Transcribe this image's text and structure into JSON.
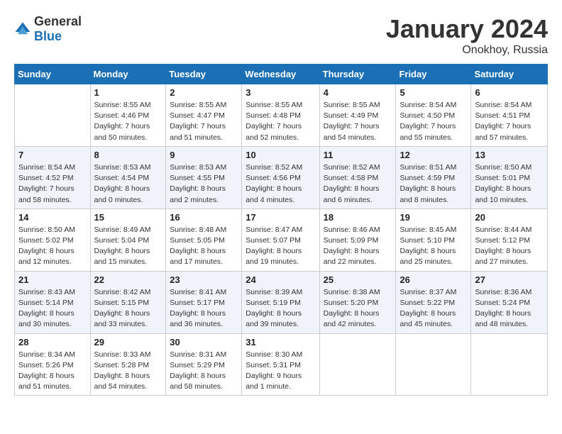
{
  "logo": {
    "general": "General",
    "blue": "Blue"
  },
  "title": "January 2024",
  "location": "Onokhoy, Russia",
  "days_of_week": [
    "Sunday",
    "Monday",
    "Tuesday",
    "Wednesday",
    "Thursday",
    "Friday",
    "Saturday"
  ],
  "weeks": [
    [
      {
        "day": "",
        "info": ""
      },
      {
        "day": "1",
        "info": "Sunrise: 8:55 AM\nSunset: 4:46 PM\nDaylight: 7 hours\nand 50 minutes."
      },
      {
        "day": "2",
        "info": "Sunrise: 8:55 AM\nSunset: 4:47 PM\nDaylight: 7 hours\nand 51 minutes."
      },
      {
        "day": "3",
        "info": "Sunrise: 8:55 AM\nSunset: 4:48 PM\nDaylight: 7 hours\nand 52 minutes."
      },
      {
        "day": "4",
        "info": "Sunrise: 8:55 AM\nSunset: 4:49 PM\nDaylight: 7 hours\nand 54 minutes."
      },
      {
        "day": "5",
        "info": "Sunrise: 8:54 AM\nSunset: 4:50 PM\nDaylight: 7 hours\nand 55 minutes."
      },
      {
        "day": "6",
        "info": "Sunrise: 8:54 AM\nSunset: 4:51 PM\nDaylight: 7 hours\nand 57 minutes."
      }
    ],
    [
      {
        "day": "7",
        "info": "Sunrise: 8:54 AM\nSunset: 4:52 PM\nDaylight: 7 hours\nand 58 minutes."
      },
      {
        "day": "8",
        "info": "Sunrise: 8:53 AM\nSunset: 4:54 PM\nDaylight: 8 hours\nand 0 minutes."
      },
      {
        "day": "9",
        "info": "Sunrise: 8:53 AM\nSunset: 4:55 PM\nDaylight: 8 hours\nand 2 minutes."
      },
      {
        "day": "10",
        "info": "Sunrise: 8:52 AM\nSunset: 4:56 PM\nDaylight: 8 hours\nand 4 minutes."
      },
      {
        "day": "11",
        "info": "Sunrise: 8:52 AM\nSunset: 4:58 PM\nDaylight: 8 hours\nand 6 minutes."
      },
      {
        "day": "12",
        "info": "Sunrise: 8:51 AM\nSunset: 4:59 PM\nDaylight: 8 hours\nand 8 minutes."
      },
      {
        "day": "13",
        "info": "Sunrise: 8:50 AM\nSunset: 5:01 PM\nDaylight: 8 hours\nand 10 minutes."
      }
    ],
    [
      {
        "day": "14",
        "info": "Sunrise: 8:50 AM\nSunset: 5:02 PM\nDaylight: 8 hours\nand 12 minutes."
      },
      {
        "day": "15",
        "info": "Sunrise: 8:49 AM\nSunset: 5:04 PM\nDaylight: 8 hours\nand 15 minutes."
      },
      {
        "day": "16",
        "info": "Sunrise: 8:48 AM\nSunset: 5:05 PM\nDaylight: 8 hours\nand 17 minutes."
      },
      {
        "day": "17",
        "info": "Sunrise: 8:47 AM\nSunset: 5:07 PM\nDaylight: 8 hours\nand 19 minutes."
      },
      {
        "day": "18",
        "info": "Sunrise: 8:46 AM\nSunset: 5:09 PM\nDaylight: 8 hours\nand 22 minutes."
      },
      {
        "day": "19",
        "info": "Sunrise: 8:45 AM\nSunset: 5:10 PM\nDaylight: 8 hours\nand 25 minutes."
      },
      {
        "day": "20",
        "info": "Sunrise: 8:44 AM\nSunset: 5:12 PM\nDaylight: 8 hours\nand 27 minutes."
      }
    ],
    [
      {
        "day": "21",
        "info": "Sunrise: 8:43 AM\nSunset: 5:14 PM\nDaylight: 8 hours\nand 30 minutes."
      },
      {
        "day": "22",
        "info": "Sunrise: 8:42 AM\nSunset: 5:15 PM\nDaylight: 8 hours\nand 33 minutes."
      },
      {
        "day": "23",
        "info": "Sunrise: 8:41 AM\nSunset: 5:17 PM\nDaylight: 8 hours\nand 36 minutes."
      },
      {
        "day": "24",
        "info": "Sunrise: 8:39 AM\nSunset: 5:19 PM\nDaylight: 8 hours\nand 39 minutes."
      },
      {
        "day": "25",
        "info": "Sunrise: 8:38 AM\nSunset: 5:20 PM\nDaylight: 8 hours\nand 42 minutes."
      },
      {
        "day": "26",
        "info": "Sunrise: 8:37 AM\nSunset: 5:22 PM\nDaylight: 8 hours\nand 45 minutes."
      },
      {
        "day": "27",
        "info": "Sunrise: 8:36 AM\nSunset: 5:24 PM\nDaylight: 8 hours\nand 48 minutes."
      }
    ],
    [
      {
        "day": "28",
        "info": "Sunrise: 8:34 AM\nSunset: 5:26 PM\nDaylight: 8 hours\nand 51 minutes."
      },
      {
        "day": "29",
        "info": "Sunrise: 8:33 AM\nSunset: 5:28 PM\nDaylight: 8 hours\nand 54 minutes."
      },
      {
        "day": "30",
        "info": "Sunrise: 8:31 AM\nSunset: 5:29 PM\nDaylight: 8 hours\nand 58 minutes."
      },
      {
        "day": "31",
        "info": "Sunrise: 8:30 AM\nSunset: 5:31 PM\nDaylight: 9 hours\nand 1 minute."
      },
      {
        "day": "",
        "info": ""
      },
      {
        "day": "",
        "info": ""
      },
      {
        "day": "",
        "info": ""
      }
    ]
  ]
}
